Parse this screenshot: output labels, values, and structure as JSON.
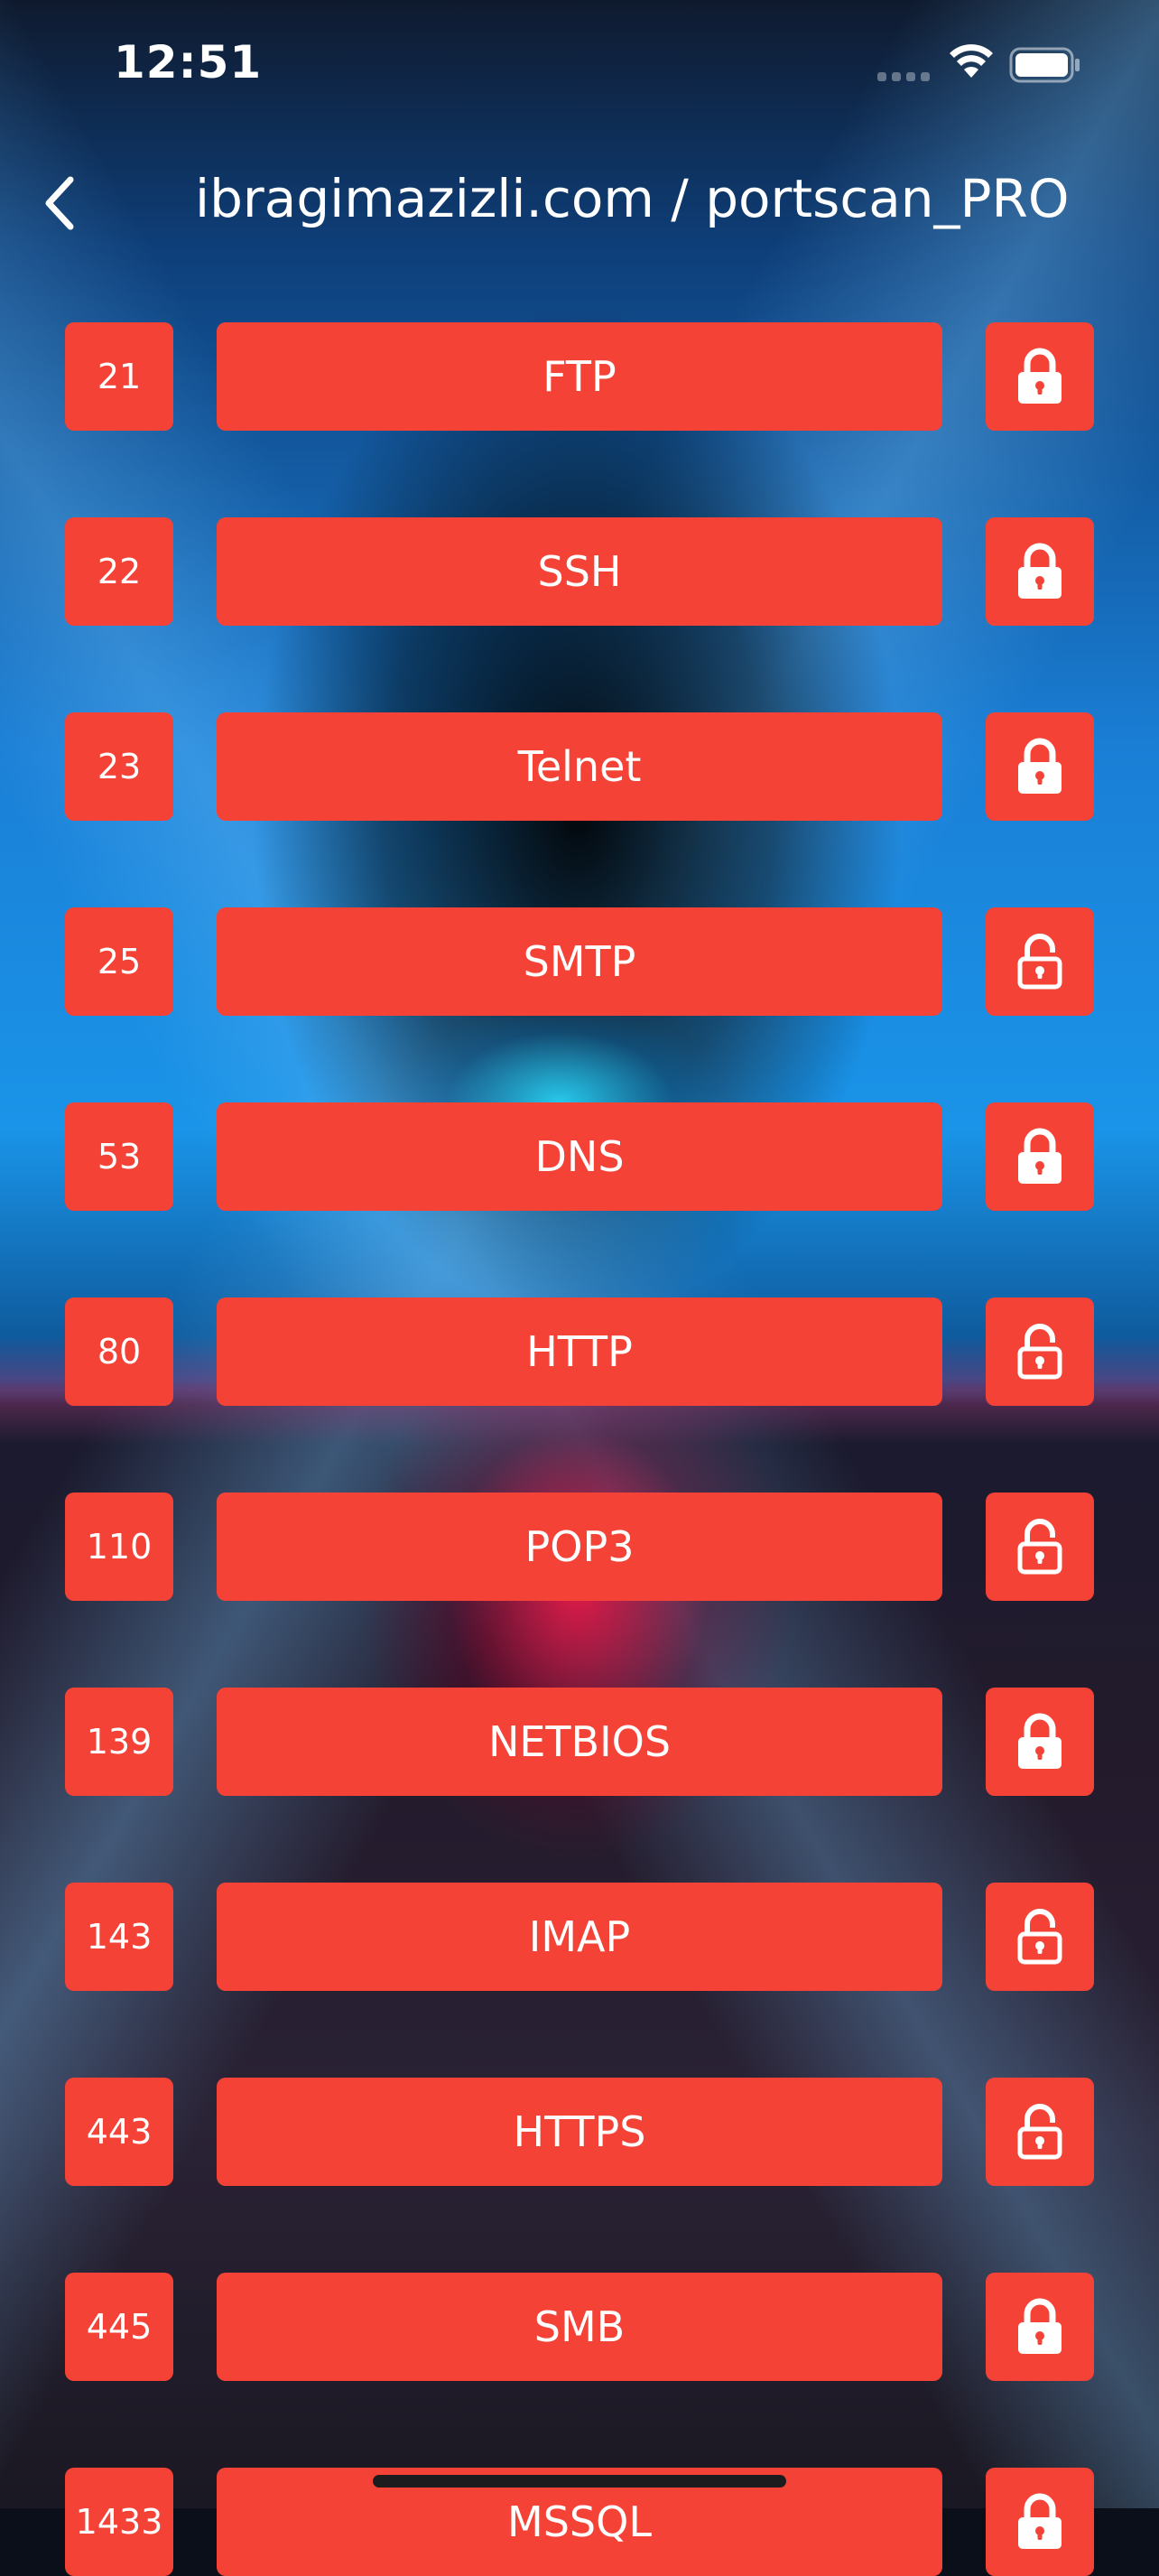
{
  "status_bar": {
    "time": "12:51"
  },
  "header": {
    "title": "ibragimazizli.com / portscan_PRO",
    "back_icon": "chevron-left-icon"
  },
  "colors": {
    "accent": "#f44336",
    "text": "#ffffff"
  },
  "ports": [
    {
      "port": "21",
      "service": "FTP",
      "status": "locked"
    },
    {
      "port": "22",
      "service": "SSH",
      "status": "locked"
    },
    {
      "port": "23",
      "service": "Telnet",
      "status": "locked"
    },
    {
      "port": "25",
      "service": "SMTP",
      "status": "unlocked"
    },
    {
      "port": "53",
      "service": "DNS",
      "status": "locked"
    },
    {
      "port": "80",
      "service": "HTTP",
      "status": "unlocked"
    },
    {
      "port": "110",
      "service": "POP3",
      "status": "unlocked"
    },
    {
      "port": "139",
      "service": "NETBIOS",
      "status": "locked"
    },
    {
      "port": "143",
      "service": "IMAP",
      "status": "unlocked"
    },
    {
      "port": "443",
      "service": "HTTPS",
      "status": "unlocked"
    },
    {
      "port": "445",
      "service": "SMB",
      "status": "locked"
    },
    {
      "port": "1433",
      "service": "MSSQL",
      "status": "locked"
    }
  ]
}
